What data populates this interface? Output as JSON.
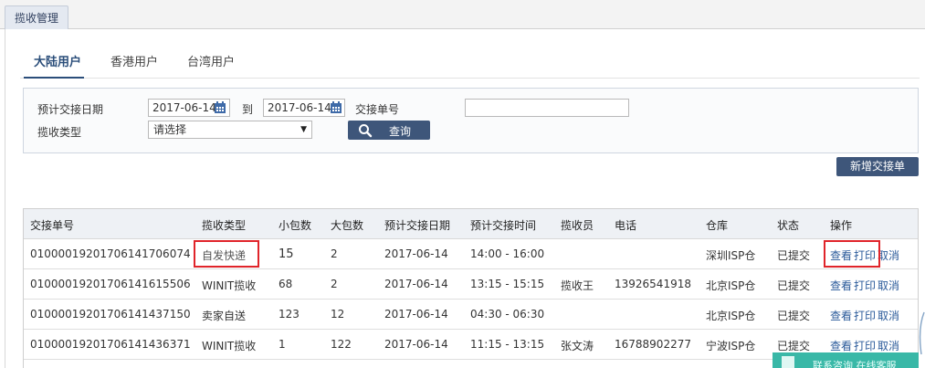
{
  "module_tab": "揽收管理",
  "user_tabs": [
    "大陆用户",
    "香港用户",
    "台湾用户"
  ],
  "filter": {
    "date_label": "预计交接日期",
    "date_from": "2017-06-14",
    "date_sep": "到",
    "date_to": "2017-06-14",
    "order_label": "交接单号",
    "order_value": "",
    "type_label": "揽收类型",
    "type_selected": "请选择",
    "query_label": "查询"
  },
  "new_button": "新增交接单",
  "table": {
    "headers": [
      "交接单号",
      "揽收类型",
      "小包数",
      "大包数",
      "预计交接日期",
      "预计交接时间",
      "揽收员",
      "电话",
      "仓库",
      "状态",
      "操作"
    ],
    "rows": [
      {
        "order": "0100001920170614170607​4",
        "type": "自发快递",
        "small": "15",
        "big": "2",
        "date": "2017-06-14",
        "time": "14:00 - 16:00",
        "collector": "",
        "phone": "",
        "warehouse": "深圳ISP仓",
        "status": "已提交",
        "actions": [
          "查看",
          "打印",
          "取消"
        ]
      },
      {
        "order": "01000019201706141615506",
        "type": "WINIT揽收",
        "small": "68",
        "big": "2",
        "date": "2017-06-14",
        "time": "13:15 - 15:15",
        "collector": "揽收王",
        "phone": "13926541918",
        "warehouse": "北京ISP仓",
        "status": "已提交",
        "actions": [
          "查看",
          "打印",
          "取消"
        ]
      },
      {
        "order": "01000019201706141437150",
        "type": "卖家自送",
        "small": "123",
        "big": "12",
        "date": "2017-06-14",
        "time": "04:30 - 06:30",
        "collector": "",
        "phone": "",
        "warehouse": "北京ISP仓",
        "status": "已提交",
        "actions": [
          "查看",
          "打印",
          "取消"
        ]
      },
      {
        "order": "01000019201706141436371",
        "type": "WINIT揽收",
        "small": "1",
        "big": "122",
        "date": "2017-06-14",
        "time": "11:15 - 13:15",
        "collector": "张文涛",
        "phone": "16788902277",
        "warehouse": "宁波ISP仓",
        "status": "已提交",
        "actions": [
          "查看",
          "打印",
          "取消"
        ]
      }
    ]
  },
  "chat_widget": "联系咨询  在线客服",
  "colors": {
    "accent": "#3e567a",
    "highlight": "#e0242a",
    "link": "#2a5a9a",
    "chat": "#39b8a7"
  }
}
